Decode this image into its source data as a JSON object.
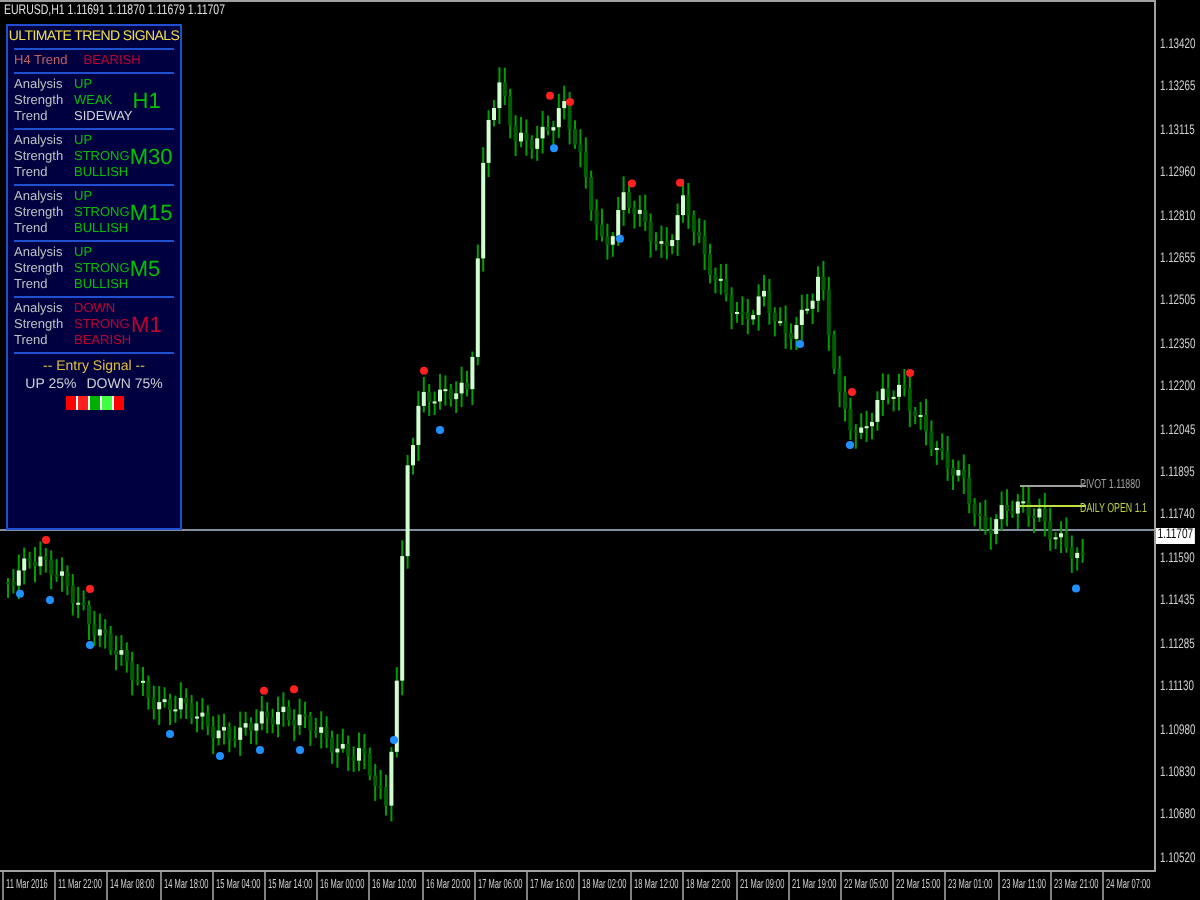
{
  "chart_title": "EURUSD,H1  1.11691 1.11870 1.11679 1.11707",
  "panel": {
    "title": "ULTIMATE TREND SIGNALS",
    "h4": {
      "label": "H4 Trend",
      "value": "BEARISH",
      "color": "#c00030"
    },
    "sections": [
      {
        "timeframe": "H1",
        "color": "#00c000",
        "rows": [
          {
            "label": "Analysis",
            "value": "UP",
            "color": "#00c000"
          },
          {
            "label": "Strength",
            "value": "WEAK",
            "color": "#00c000"
          },
          {
            "label": "Trend",
            "value": "SIDEWAY",
            "color": "#d0d0d0"
          }
        ]
      },
      {
        "timeframe": "M30",
        "color": "#00c000",
        "rows": [
          {
            "label": "Analysis",
            "value": "UP",
            "color": "#00c000"
          },
          {
            "label": "Strength",
            "value": "STRONG",
            "color": "#00c000"
          },
          {
            "label": "Trend",
            "value": "BULLISH",
            "color": "#00c000"
          }
        ]
      },
      {
        "timeframe": "M15",
        "color": "#00c000",
        "rows": [
          {
            "label": "Analysis",
            "value": "UP",
            "color": "#00c000"
          },
          {
            "label": "Strength",
            "value": "STRONG",
            "color": "#00c000"
          },
          {
            "label": "Trend",
            "value": "BULLISH",
            "color": "#00c000"
          }
        ]
      },
      {
        "timeframe": "M5",
        "color": "#00c000",
        "rows": [
          {
            "label": "Analysis",
            "value": "UP",
            "color": "#00c000"
          },
          {
            "label": "Strength",
            "value": "STRONG",
            "color": "#00c000"
          },
          {
            "label": "Trend",
            "value": "BULLISH",
            "color": "#00c000"
          }
        ]
      },
      {
        "timeframe": "M1",
        "color": "#c00030",
        "rows": [
          {
            "label": "Analysis",
            "value": "DOWN",
            "color": "#c00030"
          },
          {
            "label": "Strength",
            "value": "STRONG",
            "color": "#c00030"
          },
          {
            "label": "Trend",
            "value": "BEARISH",
            "color": "#c00030"
          }
        ]
      }
    ],
    "entry_signal": {
      "title": "-- Entry Signal --",
      "up": "UP 25%",
      "down": "DOWN 75%",
      "segments": [
        {
          "color": "#ff0000"
        },
        {
          "color": "#ff2020"
        },
        {
          "color": "#00b000"
        },
        {
          "color": "#40ff40"
        },
        {
          "color": "#ff0000"
        }
      ]
    }
  },
  "pivot": {
    "label": "PIVOT 1.11880"
  },
  "daily_open": {
    "label": "DAILY OPEN 1.1"
  },
  "current_price": "1.11707",
  "price_axis": [
    "1.13420",
    "1.13265",
    "1.13115",
    "1.12960",
    "1.12810",
    "1.12655",
    "1.12505",
    "1.12350",
    "1.12200",
    "1.12045",
    "1.11895",
    "1.11740",
    "1.11590",
    "1.11435",
    "1.11285",
    "1.11130",
    "1.10980",
    "1.10830",
    "1.10680",
    "1.10520"
  ],
  "time_axis": [
    "11 Mar 2016",
    "11 Mar 22:00",
    "14 Mar 08:00",
    "14 Mar 18:00",
    "15 Mar 04:00",
    "15 Mar 14:00",
    "16 Mar 00:00",
    "16 Mar 10:00",
    "16 Mar 20:00",
    "17 Mar 06:00",
    "17 Mar 16:00",
    "18 Mar 02:00",
    "18 Mar 12:00",
    "18 Mar 22:00",
    "21 Mar 09:00",
    "21 Mar 19:00",
    "22 Mar 05:00",
    "22 Mar 15:00",
    "23 Mar 01:00",
    "23 Mar 11:00",
    "23 Mar 21:00",
    "24 Mar 07:00"
  ]
}
